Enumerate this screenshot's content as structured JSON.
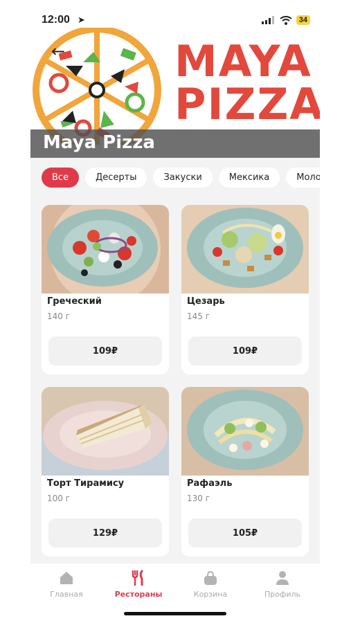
{
  "status_bar": {
    "time": "12:00",
    "battery": "34"
  },
  "header": {
    "logo_line1": "MAYA",
    "logo_line2": "PIZZA",
    "title": "Maya Pizza"
  },
  "chips": [
    {
      "label": "Все",
      "active": true
    },
    {
      "label": "Десерты"
    },
    {
      "label": "Закуски"
    },
    {
      "label": "Мексика"
    },
    {
      "label": "Молочн"
    }
  ],
  "products": [
    {
      "name": "Греческий",
      "weight": "140 г",
      "price": "109₽"
    },
    {
      "name": "Цезарь",
      "weight": "145 г",
      "price": "109₽"
    },
    {
      "name": "Торт Тирамису",
      "weight": "100 г",
      "price": "129₽"
    },
    {
      "name": "Рафаэль",
      "weight": "130 г",
      "price": "105₽"
    }
  ],
  "tabbar": {
    "items": [
      {
        "label": "Главная",
        "icon": "home-icon"
      },
      {
        "label": "Рестораны",
        "icon": "fork-knife-icon",
        "active": true
      },
      {
        "label": "Корзина",
        "icon": "basket-icon"
      },
      {
        "label": "Профиль",
        "icon": "profile-icon"
      }
    ]
  },
  "colors": {
    "accent": "#e03a4a",
    "logo_red": "#e3483d",
    "logo_orange": "#f1a53a",
    "logo_green": "#5bb548"
  }
}
